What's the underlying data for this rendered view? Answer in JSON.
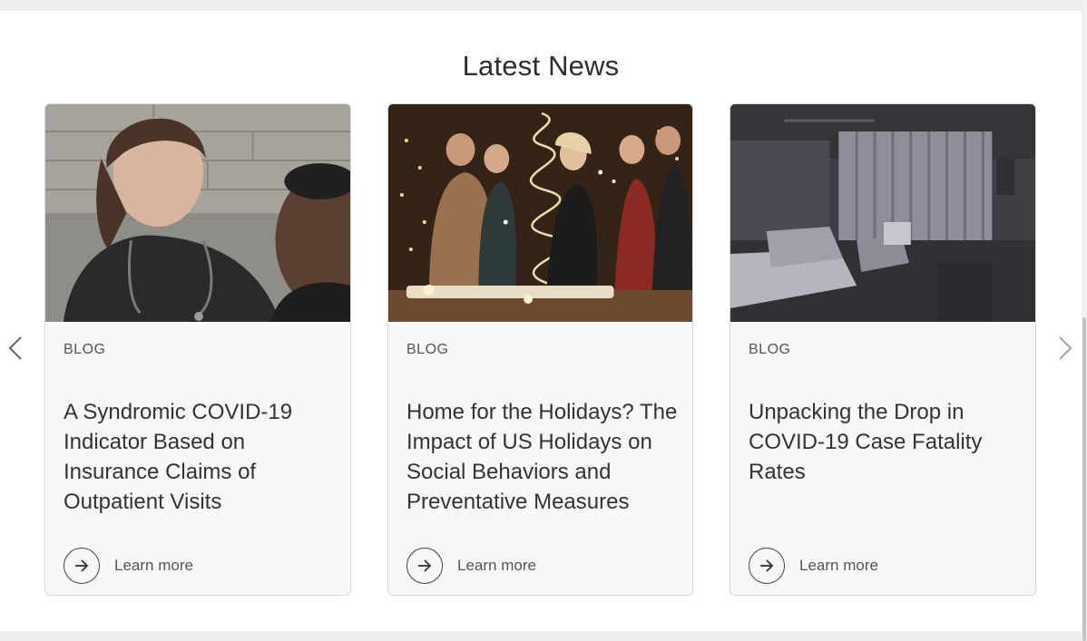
{
  "section": {
    "title": "Latest News",
    "prev_label": "‹",
    "next_label": "›"
  },
  "cards": [
    {
      "category": "BLOG",
      "title": "A Syndromic COVID-19 Indicator Based on Insurance Claims of Outpatient Visits",
      "link_label": "Learn more",
      "image": "photo of smiling healthcare worker with stethoscope"
    },
    {
      "category": "BLOG",
      "title": "Home for the Holidays? The Impact of US Holidays on Social Behaviors and Preventative Measures",
      "link_label": "Learn more",
      "image": "photo of people celebrating holiday party with sparklers"
    },
    {
      "category": "BLOG",
      "title": "Unpacking the Drop in COVID-19 Case Fatality Rates",
      "link_label": "Learn more",
      "image": "photo of empty hospital room with beds"
    }
  ],
  "icons": {
    "prev": "chevron-left-icon",
    "next": "chevron-right-icon",
    "link": "arrow-right-icon"
  }
}
